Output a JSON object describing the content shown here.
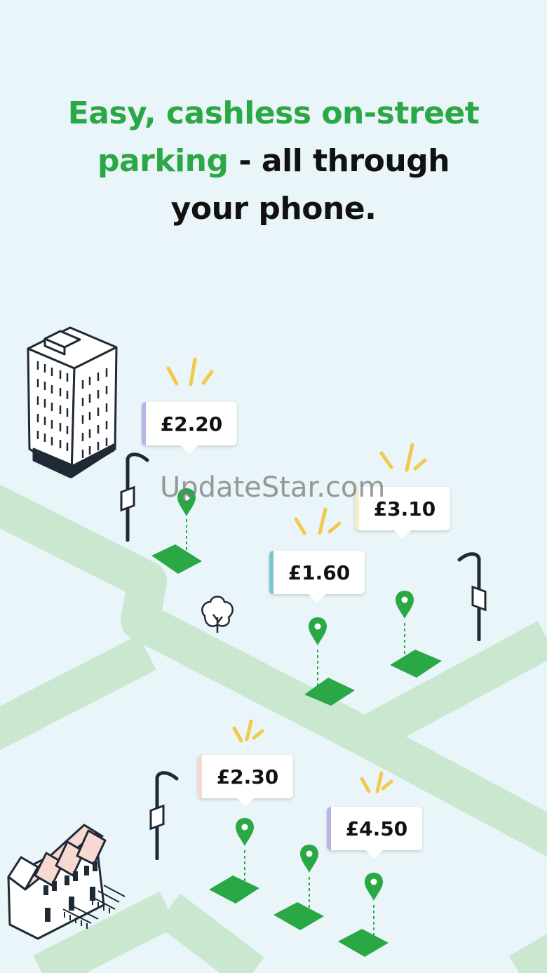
{
  "headline": {
    "line1_green": "Easy, cashless on-street",
    "line2_green": "parking",
    "line2_rest": " - all through",
    "line3": "your phone."
  },
  "price_tags": [
    {
      "name": "price-tag-2-20",
      "label": "£2.20",
      "accent": "#b6b5ea"
    },
    {
      "name": "price-tag-3-10",
      "label": "£3.10",
      "accent": "#f6ecc7"
    },
    {
      "name": "price-tag-1-60",
      "label": "£1.60",
      "accent": "#7ec4cf"
    },
    {
      "name": "price-tag-2-30",
      "label": "£2.30",
      "accent": "#f7d9d2"
    },
    {
      "name": "price-tag-4-50",
      "label": "£4.50",
      "accent": "#b6b5ea"
    }
  ],
  "watermark": "UpdateStar.com",
  "colors": {
    "background": "#e9f5f8",
    "road": "#c9e8cf",
    "brand_green": "#2aa845",
    "spark": "#f2c94c",
    "ink": "#1f2a36"
  },
  "icons": [
    "apartment-building-icon",
    "terraced-houses-icon",
    "street-lamp-icon",
    "tree-icon",
    "map-pin-icon",
    "parking-bay-icon",
    "sparkle-icon"
  ]
}
